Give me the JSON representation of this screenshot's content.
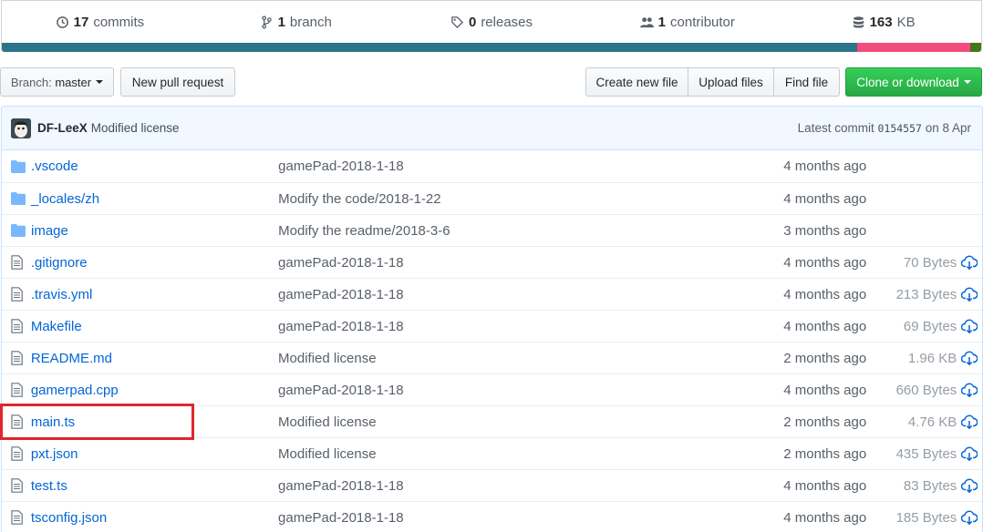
{
  "summary": {
    "commits_count": "17",
    "commits_label": "commits",
    "branch_count": "1",
    "branch_label": "branch",
    "releases_count": "0",
    "releases_label": "releases",
    "contributor_count": "1",
    "contributor_label": "contributor",
    "size_value": "163",
    "size_unit": "KB"
  },
  "language_colors": [
    "#2b7489",
    "#f34b7d",
    "#427819"
  ],
  "toolbar": {
    "branch_prefix": "Branch:",
    "branch_name": "master",
    "new_pull_request": "New pull request",
    "create_new_file": "Create new file",
    "upload_files": "Upload files",
    "find_file": "Find file",
    "clone_or_download": "Clone or download"
  },
  "commit": {
    "author": "DF-LeeX",
    "message": "Modified license",
    "latest_prefix": "Latest commit",
    "sha": "0154557",
    "date": "on 8 Apr"
  },
  "files": [
    {
      "type": "dir",
      "name": ".vscode",
      "message": "gamePad-2018-1-18",
      "age": "4 months ago",
      "size": ""
    },
    {
      "type": "dir",
      "name": "_locales/zh",
      "message": "Modify the code/2018-1-22",
      "age": "4 months ago",
      "size": ""
    },
    {
      "type": "dir",
      "name": "image",
      "message": "Modify the readme/2018-3-6",
      "age": "3 months ago",
      "size": ""
    },
    {
      "type": "file",
      "name": ".gitignore",
      "message": "gamePad-2018-1-18",
      "age": "4 months ago",
      "size": "70 Bytes"
    },
    {
      "type": "file",
      "name": ".travis.yml",
      "message": "gamePad-2018-1-18",
      "age": "4 months ago",
      "size": "213 Bytes"
    },
    {
      "type": "file",
      "name": "Makefile",
      "message": "gamePad-2018-1-18",
      "age": "4 months ago",
      "size": "69 Bytes"
    },
    {
      "type": "file",
      "name": "README.md",
      "message": "Modified license",
      "age": "2 months ago",
      "size": "1.96 KB"
    },
    {
      "type": "file",
      "name": "gamerpad.cpp",
      "message": "gamePad-2018-1-18",
      "age": "4 months ago",
      "size": "660 Bytes"
    },
    {
      "type": "file",
      "name": "main.ts",
      "message": "Modified license",
      "age": "2 months ago",
      "size": "4.76 KB"
    },
    {
      "type": "file",
      "name": "pxt.json",
      "message": "Modified license",
      "age": "2 months ago",
      "size": "435 Bytes"
    },
    {
      "type": "file",
      "name": "test.ts",
      "message": "gamePad-2018-1-18",
      "age": "4 months ago",
      "size": "83 Bytes"
    },
    {
      "type": "file",
      "name": "tsconfig.json",
      "message": "gamePad-2018-1-18",
      "age": "4 months ago",
      "size": "185 Bytes"
    }
  ]
}
